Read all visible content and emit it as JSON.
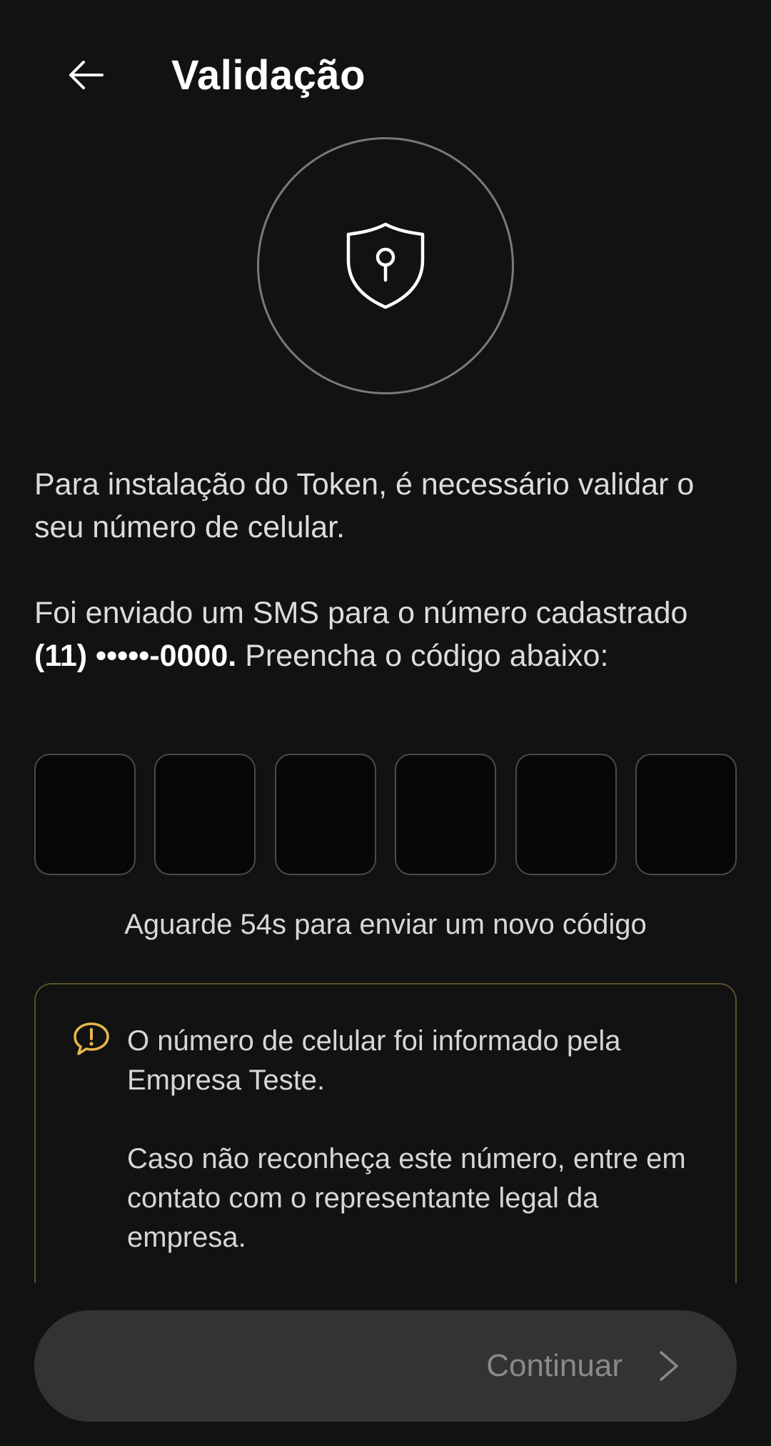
{
  "header": {
    "title": "Validação",
    "back_icon": "arrow-left-icon"
  },
  "hero": {
    "icon": "shield-keyhole-icon"
  },
  "intro": {
    "text": "Para instalação do Token, é necessário validar o seu número de celular."
  },
  "sms_info": {
    "text_before": "Foi enviado um SMS para o número cadastrado ",
    "phone": "(11) •••••-0000.",
    "text_after": " Preencha o código abaixo:"
  },
  "code": {
    "digits": [
      "",
      "",
      "",
      "",
      "",
      ""
    ]
  },
  "resend": {
    "text": "Aguarde 54s para enviar um novo código"
  },
  "notice": {
    "icon": "alert-speech-bubble-icon",
    "line1": "O número de celular foi informado pela Empresa Teste.",
    "line2": "Caso não reconheça este número, entre em contato com o representante legal da empresa."
  },
  "footer": {
    "continue_label": "Continuar",
    "continue_icon": "chevron-right-icon"
  },
  "colors": {
    "background": "#121212",
    "notice_border": "#5a5128",
    "notice_icon": "#e8b84a",
    "button_bg": "#333333",
    "button_text": "#8a8a8a"
  }
}
